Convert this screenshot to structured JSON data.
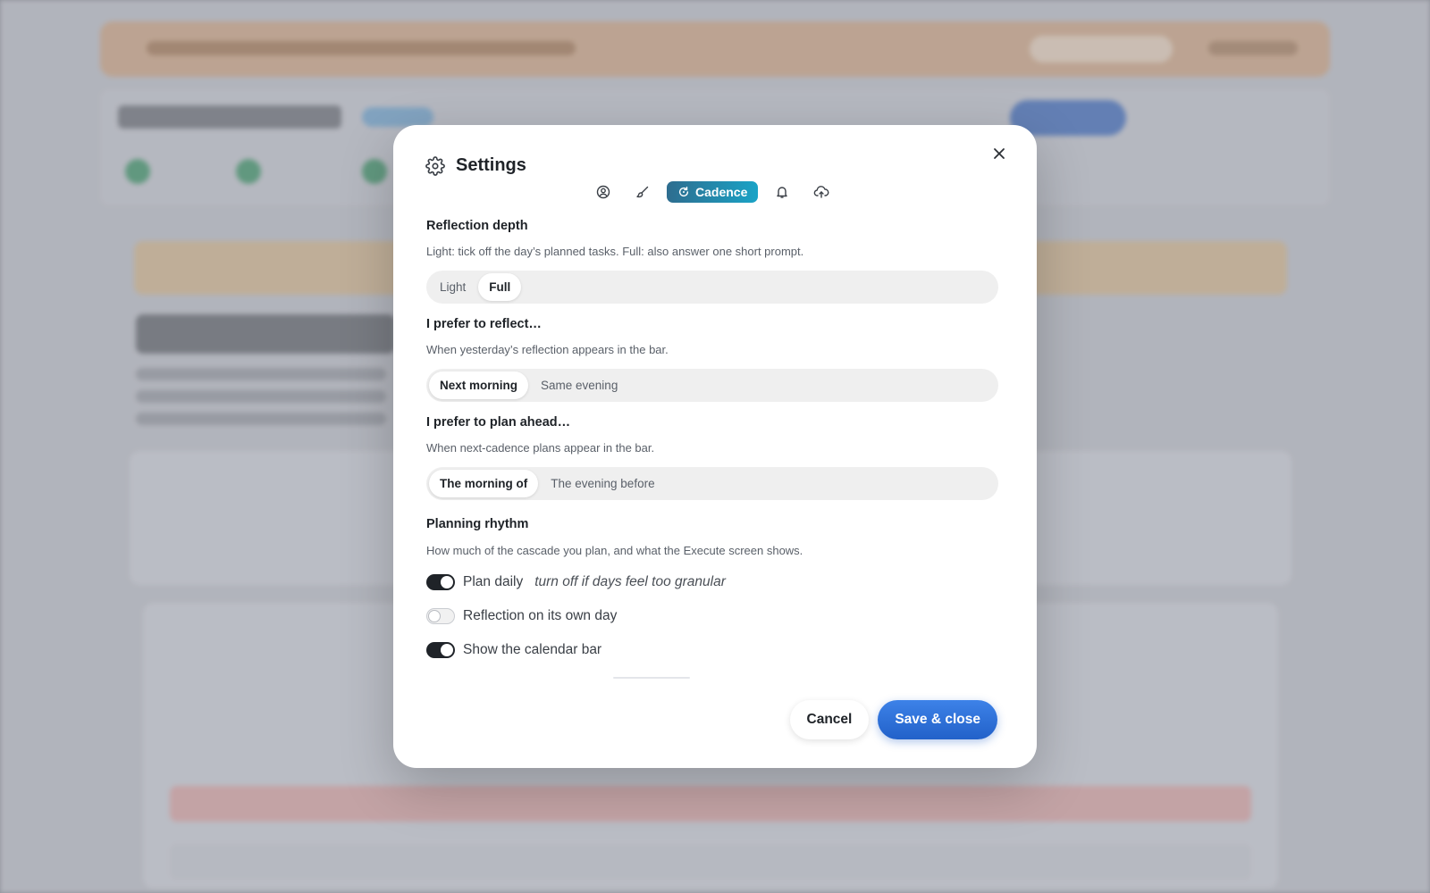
{
  "modal": {
    "title": "Settings",
    "close_icon": "close-icon",
    "tabs": [
      {
        "icon": "profile-icon"
      },
      {
        "icon": "brush-icon"
      },
      {
        "icon": "cycle-icon",
        "label": "Cadence",
        "active": true
      },
      {
        "icon": "bell-icon"
      },
      {
        "icon": "cloud-upload-icon"
      }
    ],
    "sections": {
      "reflection_depth": {
        "title": "Reflection depth",
        "desc": "Light: tick off the day’s planned tasks. Full: also answer one short prompt.",
        "options": [
          "Light",
          "Full"
        ],
        "selected": "Full"
      },
      "reflect_pref": {
        "title": "I prefer to reflect…",
        "desc": "When yesterday’s reflection appears in the bar.",
        "options": [
          "Next morning",
          "Same evening"
        ],
        "selected": "Next morning"
      },
      "plan_pref": {
        "title": "I prefer to plan ahead…",
        "desc": "When next-cadence plans appear in the bar.",
        "options": [
          "The morning of",
          "The evening before"
        ],
        "selected": "The morning of"
      },
      "planning_rhythm": {
        "title": "Planning rhythm",
        "desc": "How much of the cascade you plan, and what the Execute screen shows.",
        "toggles": [
          {
            "label": "Plan daily",
            "hint": "turn off if days feel too granular",
            "on": true
          },
          {
            "label": "Reflection on its own day",
            "hint": "",
            "on": false
          },
          {
            "label": "Show the calendar bar",
            "hint": "",
            "on": true
          }
        ]
      }
    },
    "footer": {
      "cancel": "Cancel",
      "save": "Save & close"
    }
  },
  "colors": {
    "accent_tab_start": "#2e6d8f",
    "accent_tab_end": "#1aa3c6",
    "primary": "#2261c9",
    "toggle_on": "#1f2328"
  }
}
